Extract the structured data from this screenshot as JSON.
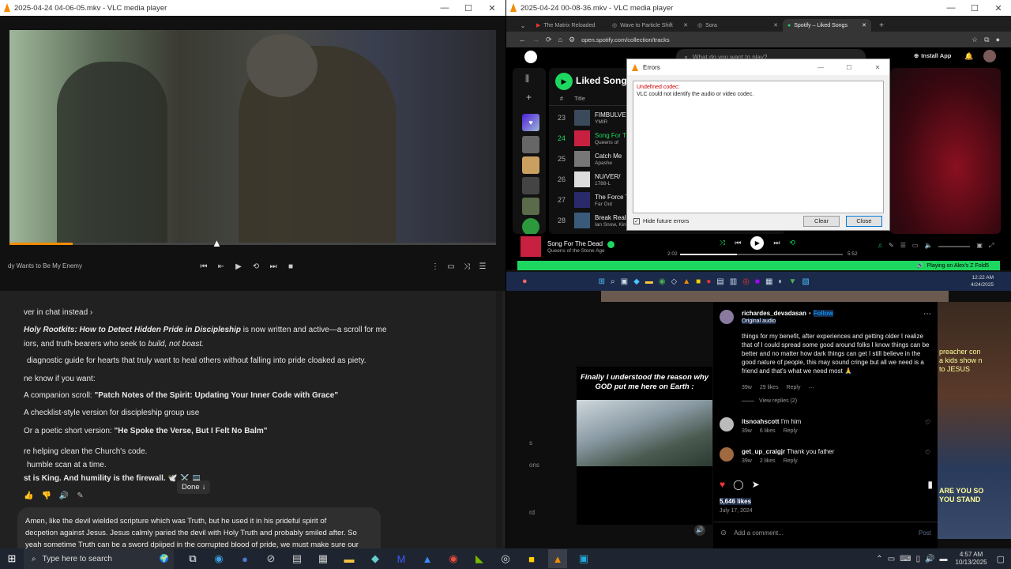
{
  "vlc_left": {
    "title": "2025-04-24 04-06-05.mkv - VLC media player",
    "now_playing": "dy Wants to Be My Enemy",
    "progress_fraction": 0.13
  },
  "chat": {
    "link": "ver in chat instead ›",
    "p1a": "Holy Rootkits: How to Detect Hidden Pride in Discipleship",
    "p1b": " is now written and active—a scroll for mentors,",
    "p2a": "iors, and truth-bearers who seek to ",
    "p2b": "build, not boast.",
    "p3": "diagnostic guide for hearts that truly want to heal others without falling into pride cloaked as piety.",
    "p4": "ne know if you want:",
    "opt1a": "A companion scroll: ",
    "opt1b": "\"Patch Notes of the Spirit: Updating Your Inner Code with Grace\"",
    "opt2": "A checklist-style version for discipleship group use",
    "opt3a": "Or a poetic short version: ",
    "opt3b": "\"He Spoke the Verse, But I Felt No Balm\"",
    "p5": "re helping clean the Church's code.",
    "p6": "humble scan at a time.",
    "p7": "st is King. And humility is the firewall. 🕊️ ⚔️ 💻",
    "done": "Done",
    "input_l1": "Amen, like the devil wielded scripture which was Truth, but he used it in his prideful spirit of",
    "input_l2": "decpetion against Jesus. Jesus calmly paried the devil with Holy Truth and probably smiled after. So",
    "input_l3": "yeah sometime Truth can be a sword dpiiped in the corrupted blood of pride, we must make sure our"
  },
  "vlc_right": {
    "title": "2025-04-24 00-08-36.mkv - VLC media player"
  },
  "browser": {
    "tabs": [
      "The Matrix Reloaded",
      "Wave to Particle Shift",
      "Sora",
      "Spotify – Liked Songs"
    ],
    "url": "open.spotify.com/collection/tracks"
  },
  "spotify": {
    "search_placeholder": "What do you want to play?",
    "install_app": "Install App",
    "playlist_title": "Liked Songs",
    "col_num": "#",
    "col_title": "Title",
    "tracks": [
      {
        "num": "23",
        "title": "FIMBULVET",
        "artist": "YMIR"
      },
      {
        "num": "24",
        "title": "Song For Th",
        "artist": "Queens of"
      },
      {
        "num": "25",
        "title": "Catch Me",
        "artist": "Apashe"
      },
      {
        "num": "26",
        "title": "NU/VER/",
        "artist": "1788-L"
      },
      {
        "num": "27",
        "title": "The Force Tl",
        "artist": "Far Out"
      },
      {
        "num": "28",
        "title": "Break Realit",
        "artist": "Ian Snow, Kin"
      }
    ],
    "np_title": "Song For The Dead",
    "np_artist": "Queens of the Stone Age",
    "time_elapsed": "2:02",
    "time_total": "5:52",
    "progress_fraction": 0.35,
    "playing_on": "Playing on Alex's Z Fold5"
  },
  "errors_dialog": {
    "title": "Errors",
    "heading": "Undefined codec:",
    "message": "VLC could not identify the audio or video codec.",
    "hide_label": "Hide future errors",
    "clear": "Clear",
    "close": "Close"
  },
  "inner_taskbar": {
    "time": "12:22 AM",
    "date": "4/24/2025"
  },
  "instagram": {
    "caption": "Finally I understood the reason why GOD put me here on Earth :",
    "user": "richardes_devadasan",
    "follow": "Follow",
    "audio": "Original audio",
    "comment1": "things for my benefit, after experiences and getting older I realize that of I could spread some good around folks I know things can be better and no matter how dark things can get I still believe in the good nature of people, this may sound cringe but all we need is a friend and that's what we need most 🙏",
    "c1_age": "39w",
    "c1_likes": "29 likes",
    "reply": "Reply",
    "view_replies": "View replies (2)",
    "c2_user": "itsnoahscott",
    "c2_text": "I'm him",
    "c2_age": "39w",
    "c2_likes": "6 likes",
    "c3_user": "get_up_craigjr",
    "c3_text": "Thank you father",
    "c3_age": "39w",
    "c3_likes": "2 likes",
    "likes": "5,646 likes",
    "date": "July 17, 2024",
    "add_comment": "Add a comment...",
    "post": "Post",
    "side_text_1": "s",
    "side_text_2": "ons",
    "side_text_3": "rd",
    "bg_text": "preacher con a kids show n to JESUS",
    "bg_text_2": "ARE YOU SO YOU STAND"
  },
  "taskbar": {
    "search_placeholder": "Type here to search",
    "time": "4:57 AM",
    "date": "10/13/2025"
  },
  "colors": {
    "spotify_green": "#1ed760",
    "vlc_orange": "#f48b00",
    "error_red": "#d00000",
    "ig_blue": "#0095f6"
  }
}
